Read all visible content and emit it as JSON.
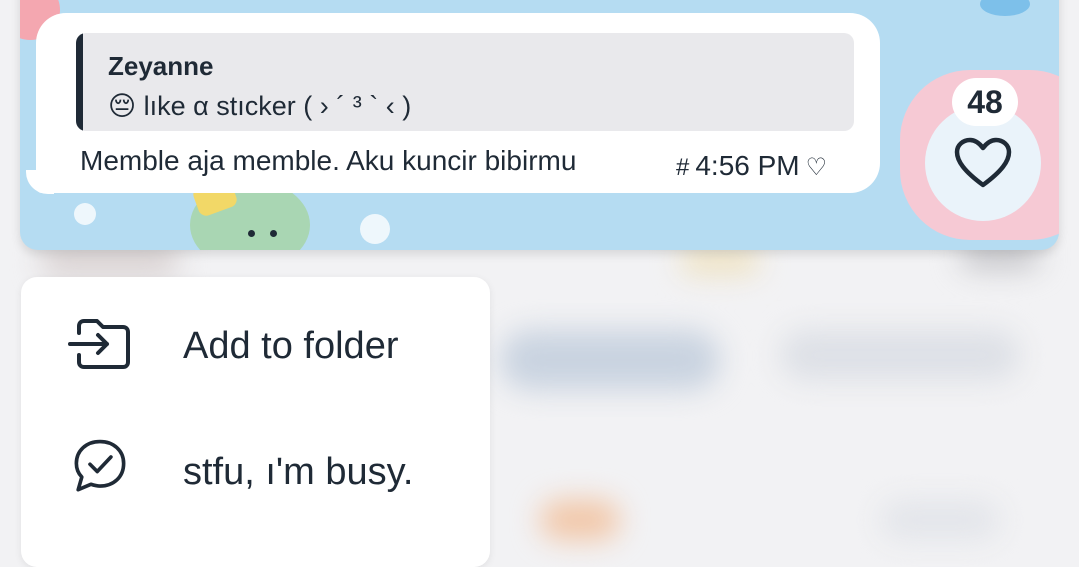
{
  "chat": {
    "reply": {
      "name": "Zeyanne",
      "text": "😔 lıke α stıcker ( › ´ ³ ` ‹ )"
    },
    "message": "Memble aja memble. Aku kuncir bibirmu",
    "tag_symbol": "#",
    "time": "4:56 PM",
    "heart_symbol": "♡"
  },
  "reaction": {
    "count": "48",
    "icon": "heart-outline-icon"
  },
  "menu": {
    "items": [
      {
        "label": "Add to folder",
        "icon": "folder-move-icon"
      },
      {
        "label": "stfu, ı'm busy.",
        "icon": "chat-check-icon"
      }
    ]
  },
  "colors": {
    "text": "#1f2a36",
    "wallpaper": "#b5dcf2",
    "bubble": "#ffffff",
    "reply_bg": "#e9e9ec"
  }
}
